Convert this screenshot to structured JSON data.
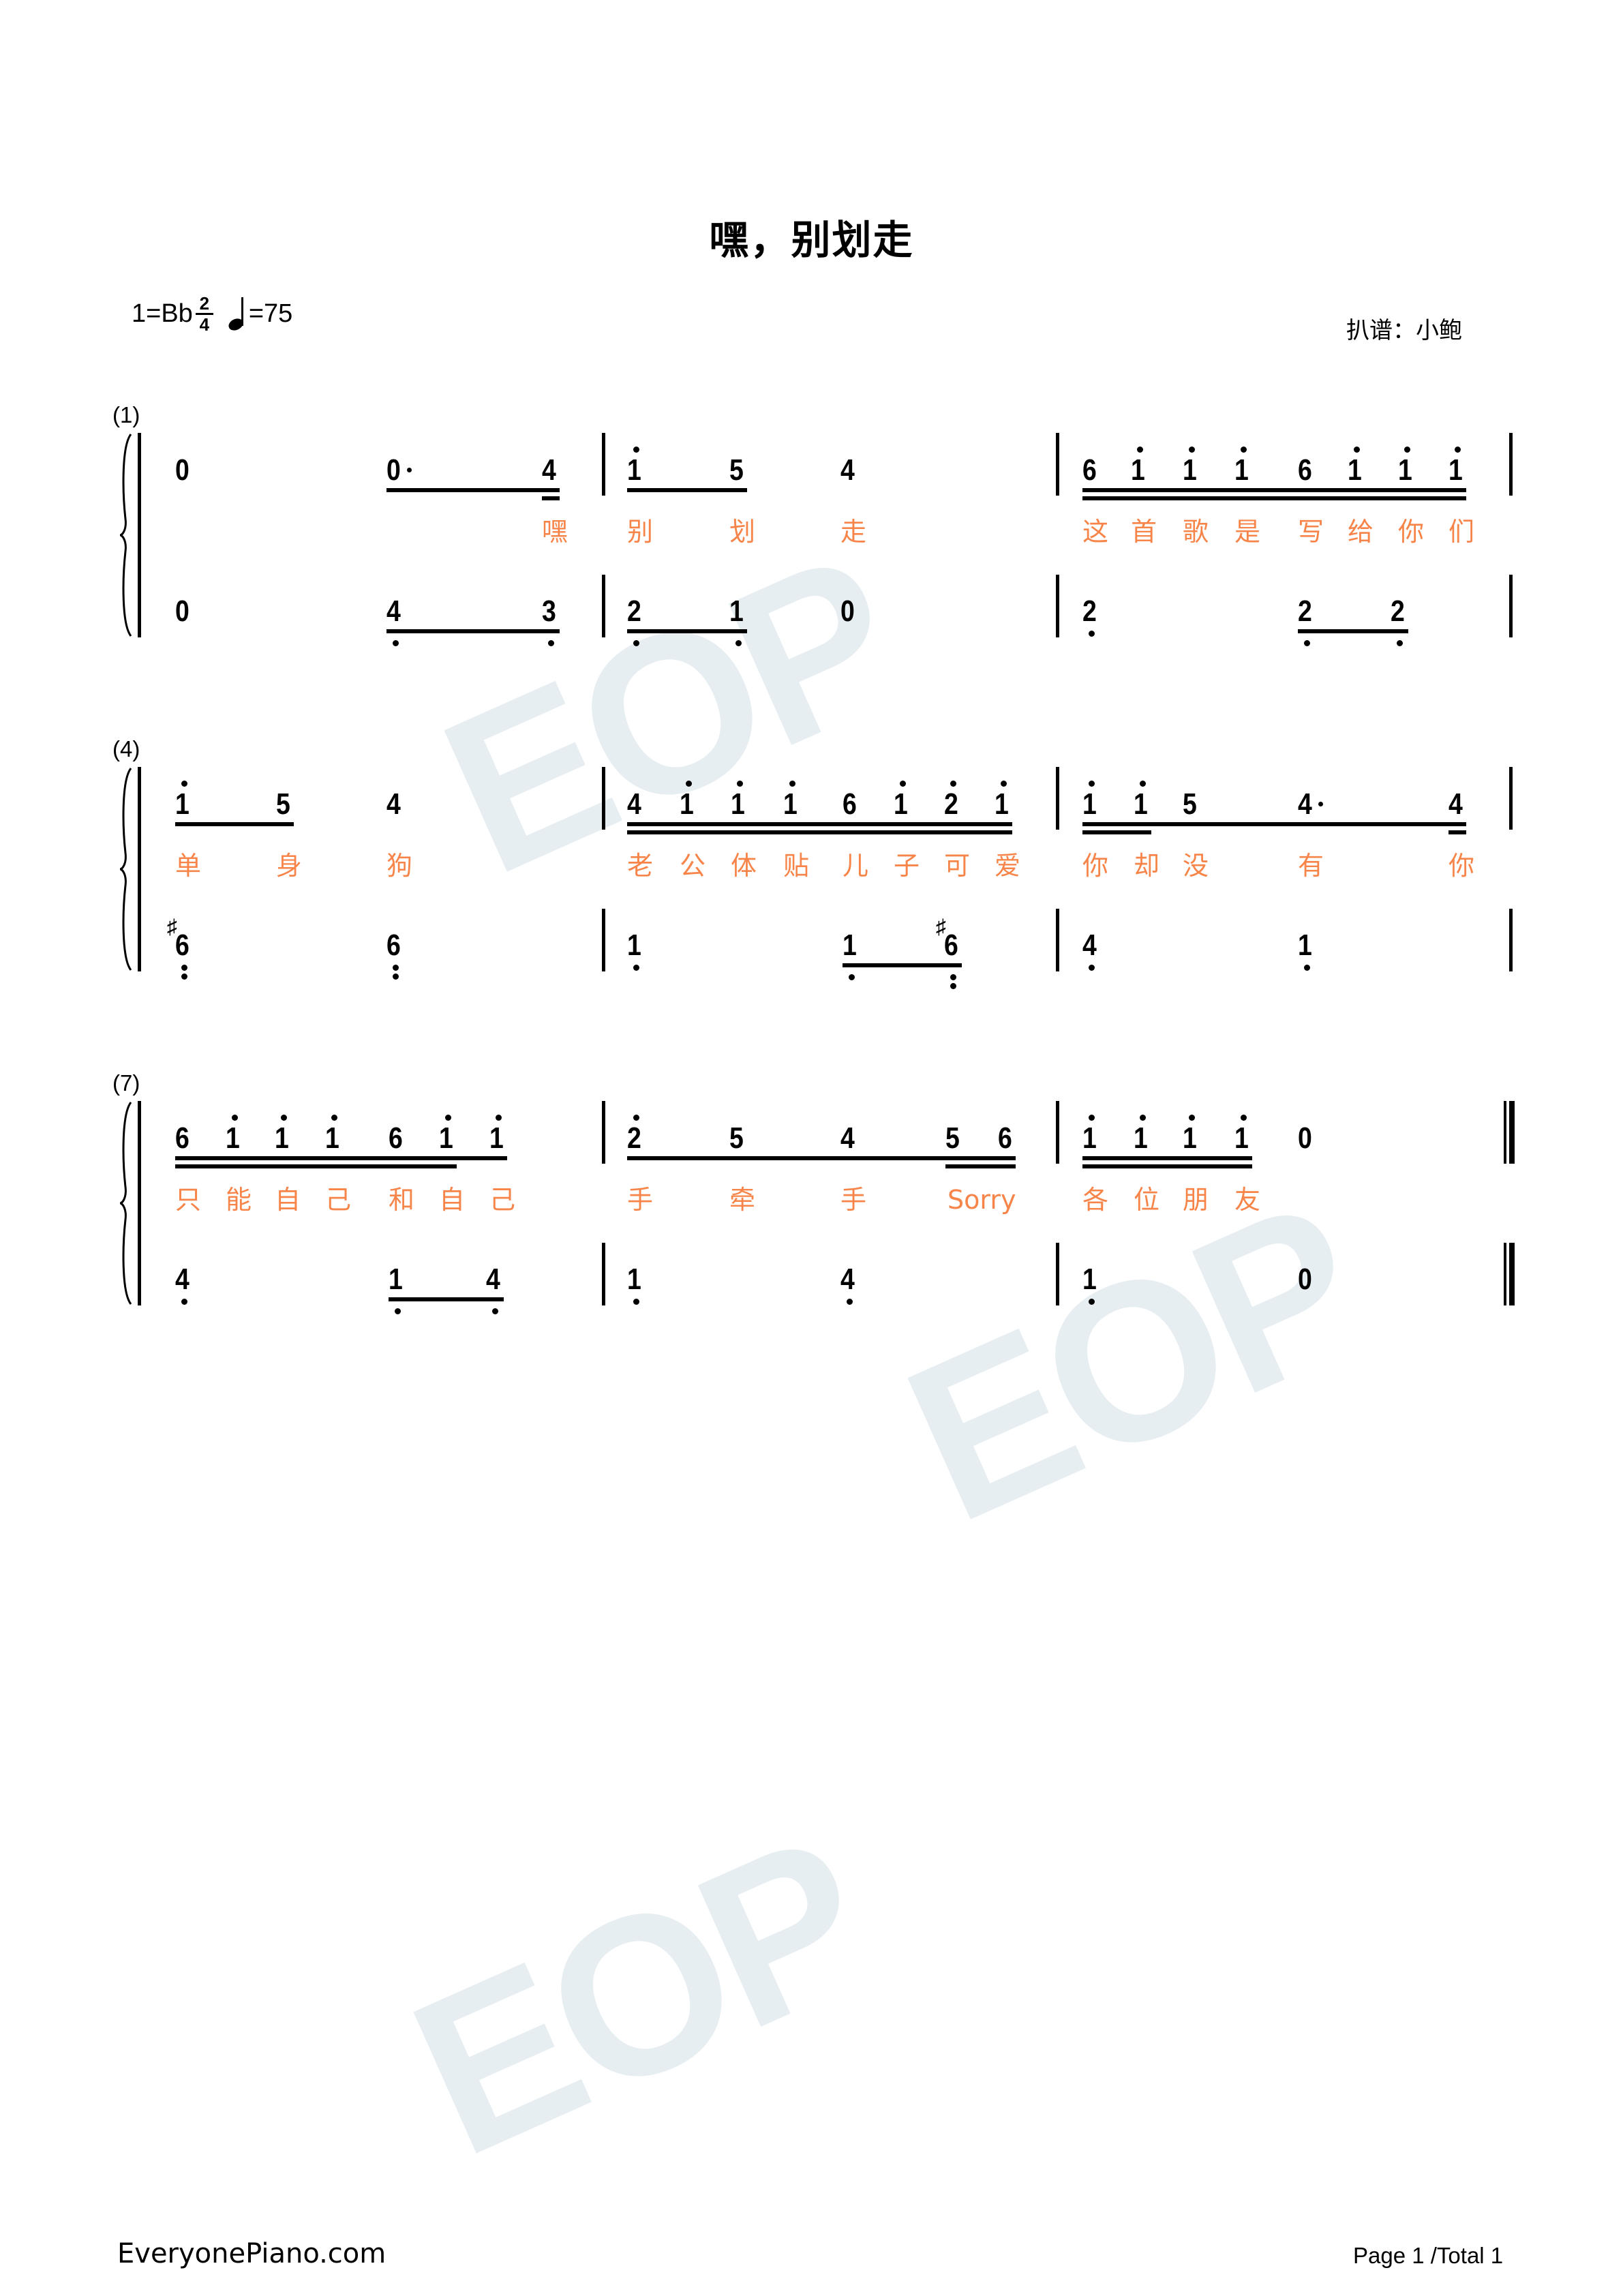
{
  "header": {
    "title": "嘿，别划走",
    "key": "1=Bb",
    "time_signature": {
      "top": "2",
      "bottom": "4"
    },
    "tempo_note_icon": "quarter-note-icon",
    "tempo": "=75",
    "arranger": "扒谱：小鲍"
  },
  "watermark": {
    "text": "EOP",
    "color": "#e6eef2"
  },
  "colors": {
    "lyrics": "#f7854a",
    "notes": "#000000"
  },
  "systems": [
    {
      "number": "(1)",
      "measures": [
        {
          "treble": [
            {
              "n": "0"
            },
            {
              "n": "0",
              "aug": true,
              "beam": 1
            },
            {
              "n": "4",
              "beam": 2
            }
          ],
          "bass": [
            {
              "n": "0"
            },
            {
              "n": "4",
              "low": 1,
              "beam": 1
            },
            {
              "n": "3",
              "low": 1,
              "beam": 1
            }
          ],
          "lyrics": [
            "",
            "",
            "嘿"
          ]
        },
        {
          "treble": [
            {
              "n": "1",
              "high": 1,
              "beam": 1
            },
            {
              "n": "5",
              "beam": 1
            },
            {
              "n": "4"
            }
          ],
          "bass": [
            {
              "n": "2",
              "low": 1,
              "beam": 1
            },
            {
              "n": "1",
              "low": 1,
              "beam": 1
            },
            {
              "n": "0"
            }
          ],
          "lyrics": [
            "别",
            "划",
            "走"
          ]
        },
        {
          "treble": [
            {
              "n": "6",
              "beam": 2
            },
            {
              "n": "1",
              "high": 1,
              "beam": 2
            },
            {
              "n": "1",
              "high": 1,
              "beam": 2
            },
            {
              "n": "1",
              "high": 1,
              "beam": 2
            },
            {
              "n": "6",
              "beam": 2
            },
            {
              "n": "1",
              "high": 1,
              "beam": 2
            },
            {
              "n": "1",
              "high": 1,
              "beam": 2
            },
            {
              "n": "1",
              "high": 1,
              "beam": 2
            }
          ],
          "bass": [
            {
              "n": "2",
              "low": 1
            },
            {
              "n": "2",
              "low": 1,
              "beam": 1
            },
            {
              "n": "2",
              "low": 1,
              "beam": 1
            }
          ],
          "lyrics": [
            "这",
            "首",
            "歌",
            "是",
            "写",
            "给",
            "你",
            "们"
          ]
        }
      ]
    },
    {
      "number": "(4)",
      "measures": [
        {
          "treble": [
            {
              "n": "1",
              "high": 1,
              "beam": 1
            },
            {
              "n": "5",
              "beam": 1
            },
            {
              "n": "4"
            }
          ],
          "bass": [
            {
              "n": "6",
              "low": 2,
              "sharp": true
            },
            {
              "n": "6",
              "low": 2
            }
          ],
          "lyrics": [
            "单",
            "身",
            "狗"
          ]
        },
        {
          "treble": [
            {
              "n": "4",
              "beam": 2
            },
            {
              "n": "1",
              "high": 1,
              "beam": 2
            },
            {
              "n": "1",
              "high": 1,
              "beam": 2
            },
            {
              "n": "1",
              "high": 1,
              "beam": 2
            },
            {
              "n": "6",
              "beam": 2
            },
            {
              "n": "1",
              "high": 1,
              "beam": 2
            },
            {
              "n": "2",
              "high": 1,
              "beam": 2
            },
            {
              "n": "1",
              "high": 1,
              "beam": 2
            }
          ],
          "bass": [
            {
              "n": "1",
              "low": 1
            },
            {
              "n": "1",
              "low": 1,
              "beam": 1
            },
            {
              "n": "6",
              "low": 2,
              "sharp": true,
              "beam": 1
            }
          ],
          "lyrics": [
            "老",
            "公",
            "体",
            "贴",
            "儿",
            "子",
            "可",
            "爱"
          ]
        },
        {
          "treble": [
            {
              "n": "1",
              "high": 1,
              "beam": 2
            },
            {
              "n": "1",
              "high": 1,
              "beam": 2
            },
            {
              "n": "5",
              "beam": 1
            },
            {
              "n": "4",
              "aug": true,
              "beam": 1
            },
            {
              "n": "4",
              "beam": 2
            }
          ],
          "bass": [
            {
              "n": "4",
              "low": 1
            },
            {
              "n": "1",
              "low": 1
            }
          ],
          "lyrics": [
            "你",
            "却",
            "没",
            "有",
            "你"
          ]
        }
      ]
    },
    {
      "number": "(7)",
      "measures": [
        {
          "treble": [
            {
              "n": "6",
              "beam": 2
            },
            {
              "n": "1",
              "high": 1,
              "beam": 2
            },
            {
              "n": "1",
              "high": 1,
              "beam": 2
            },
            {
              "n": "1",
              "high": 1,
              "beam": 2
            },
            {
              "n": "6",
              "beam": 2
            },
            {
              "n": "1",
              "high": 1,
              "beam": 2
            },
            {
              "n": "1",
              "high": 1,
              "beam": 1
            }
          ],
          "bass": [
            {
              "n": "4",
              "low": 1
            },
            {
              "n": "1",
              "low": 1,
              "beam": 1
            },
            {
              "n": "4",
              "low": 1,
              "beam": 1
            }
          ],
          "lyrics": [
            "只",
            "能",
            "自",
            "己",
            "和",
            "自",
            "己"
          ]
        },
        {
          "treble": [
            {
              "n": "2",
              "high": 1,
              "beam": 1
            },
            {
              "n": "5",
              "beam": 1
            },
            {
              "n": "4",
              "beam": 1
            },
            {
              "n": "5",
              "beam": 2
            },
            {
              "n": "6",
              "beam": 2
            }
          ],
          "bass": [
            {
              "n": "1",
              "low": 1
            },
            {
              "n": "4",
              "low": 1
            }
          ],
          "lyrics": [
            "手",
            "牵",
            "手",
            "Sorry"
          ]
        },
        {
          "treble": [
            {
              "n": "1",
              "high": 1,
              "beam": 2
            },
            {
              "n": "1",
              "high": 1,
              "beam": 2
            },
            {
              "n": "1",
              "high": 1,
              "beam": 2
            },
            {
              "n": "1",
              "high": 1,
              "beam": 2
            },
            {
              "n": "0"
            }
          ],
          "bass": [
            {
              "n": "1",
              "low": 1
            },
            {
              "n": "0"
            }
          ],
          "lyrics": [
            "各",
            "位",
            "朋",
            "友"
          ],
          "final": true
        }
      ]
    }
  ],
  "footer": {
    "site": "EveryonePiano.com",
    "page": "Page 1 /Total 1"
  }
}
